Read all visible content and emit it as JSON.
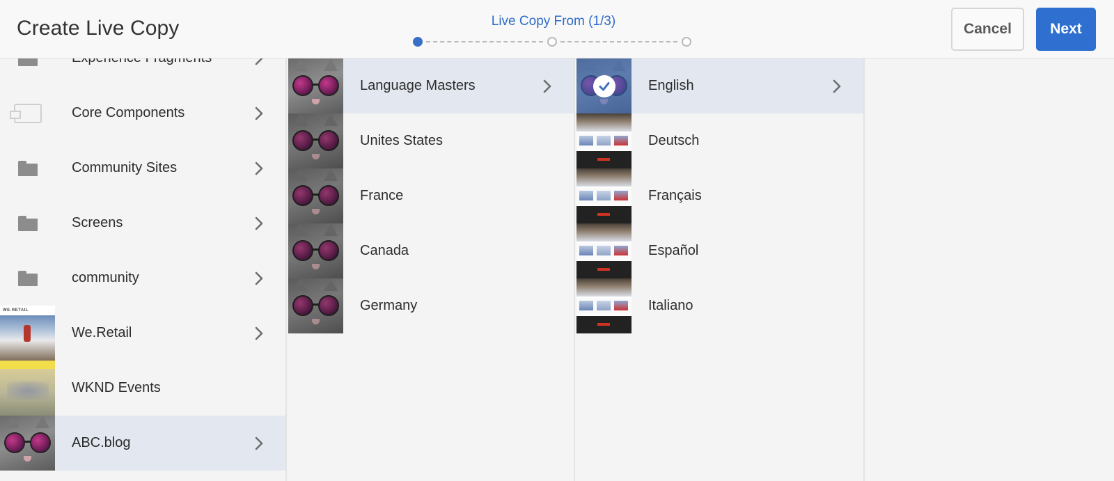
{
  "header": {
    "title": "Create Live Copy",
    "wizard_label": "Live Copy From (1/3)",
    "cancel_label": "Cancel",
    "next_label": "Next"
  },
  "wizard": {
    "steps": 3,
    "current_step": 1
  },
  "colors": {
    "accent": "#2e6fcf",
    "selected_row": "#e3e8f0",
    "background": "#f4f4f4"
  },
  "columns": {
    "col1": {
      "items": [
        {
          "label": "Experience Fragments",
          "icon": "folder-icon",
          "has_children": true,
          "selected": false
        },
        {
          "label": "Core Components",
          "icon": "component-icon",
          "has_children": true,
          "selected": false
        },
        {
          "label": "Community Sites",
          "icon": "folder-icon",
          "has_children": true,
          "selected": false
        },
        {
          "label": "Screens",
          "icon": "folder-icon",
          "has_children": true,
          "selected": false
        },
        {
          "label": "community",
          "icon": "folder-icon",
          "has_children": true,
          "selected": false
        },
        {
          "label": "We.Retail",
          "icon": "site-thumbnail",
          "has_children": true,
          "selected": false,
          "thumb_text": "WE.RETAIL"
        },
        {
          "label": "WKND Events",
          "icon": "site-thumbnail",
          "has_children": false,
          "selected": false
        },
        {
          "label": "ABC.blog",
          "icon": "cat-thumbnail",
          "has_children": true,
          "selected": true
        }
      ]
    },
    "col2": {
      "items": [
        {
          "label": "Language Masters",
          "icon": "cat-thumbnail",
          "has_children": true,
          "selected": true
        },
        {
          "label": "Unites States",
          "icon": "cat-thumbnail",
          "has_children": false,
          "selected": false
        },
        {
          "label": "France",
          "icon": "cat-thumbnail",
          "has_children": false,
          "selected": false
        },
        {
          "label": "Canada",
          "icon": "cat-thumbnail",
          "has_children": false,
          "selected": false
        },
        {
          "label": "Germany",
          "icon": "cat-thumbnail",
          "has_children": false,
          "selected": false
        }
      ]
    },
    "col3": {
      "items": [
        {
          "label": "English",
          "icon": "cat-thumbnail",
          "has_children": true,
          "selected": true,
          "checked": true
        },
        {
          "label": "Deutsch",
          "icon": "site-thumbnail",
          "has_children": false,
          "selected": false
        },
        {
          "label": "Français",
          "icon": "site-thumbnail",
          "has_children": false,
          "selected": false
        },
        {
          "label": "Español",
          "icon": "site-thumbnail",
          "has_children": false,
          "selected": false
        },
        {
          "label": "Italiano",
          "icon": "site-thumbnail",
          "has_children": false,
          "selected": false
        }
      ]
    }
  }
}
